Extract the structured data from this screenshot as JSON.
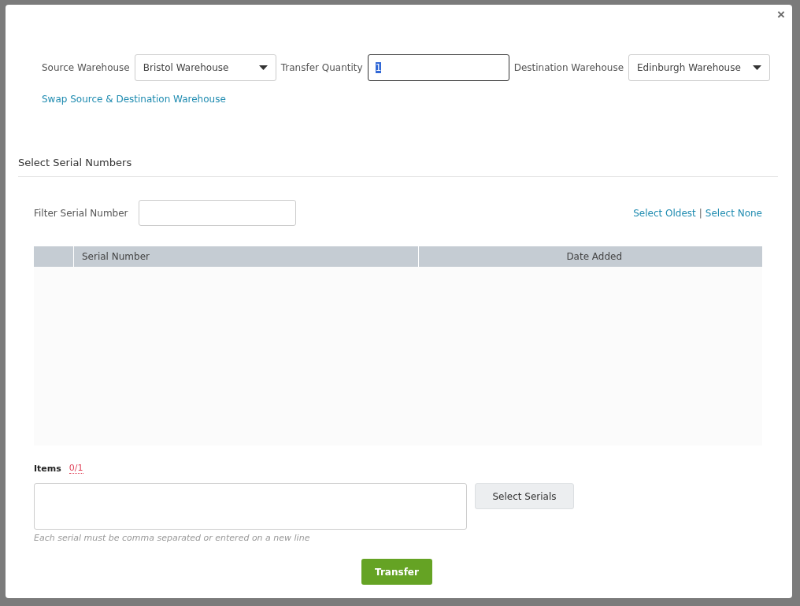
{
  "dialog": {
    "close": "×",
    "source": {
      "label": "Source Warehouse",
      "value": "Bristol Warehouse"
    },
    "quantity": {
      "label": "Transfer Quantity",
      "value": "1",
      "text_selected": true,
      "focused": true
    },
    "destination": {
      "label": "Destination Warehouse",
      "value": "Edinburgh Warehouse"
    },
    "swap_link": "Swap Source & Destination Warehouse",
    "section_title": "Select Serial Numbers",
    "filter": {
      "label": "Filter Serial Number"
    },
    "select_oldest": "Select Oldest",
    "separator": "|",
    "select_none": "Select None",
    "table": {
      "columns": [
        "Serial Number",
        "Date Added"
      ]
    },
    "items": {
      "label": "Items",
      "count": "0/1",
      "hint": "Each serial must be comma separated or entered on a new line"
    },
    "select_serials": "Select Serials",
    "transfer": "Transfer"
  }
}
